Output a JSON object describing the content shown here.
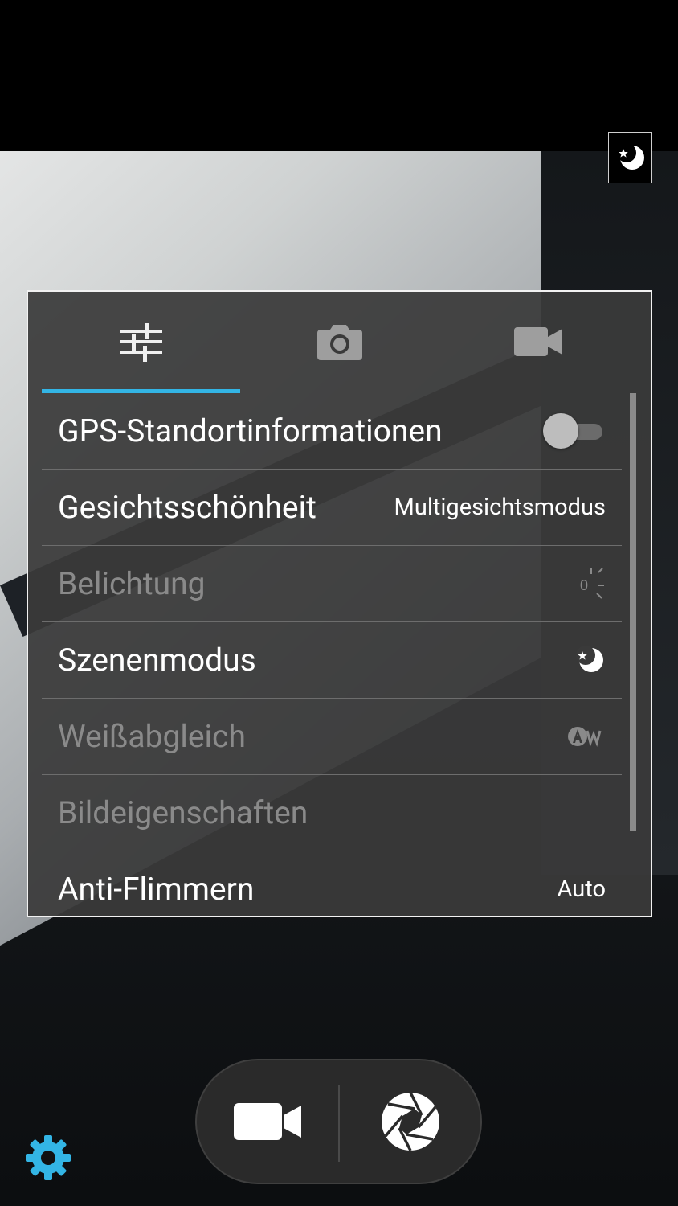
{
  "tabs": [
    {
      "name": "general",
      "icon": "sliders-icon",
      "selected": true
    },
    {
      "name": "photo",
      "icon": "camera-icon",
      "selected": false
    },
    {
      "name": "video",
      "icon": "videocam-icon",
      "selected": false
    }
  ],
  "settings": [
    {
      "label": "GPS-Standortinformationen",
      "value": "",
      "control": "toggle",
      "enabled": true,
      "toggle_on": false
    },
    {
      "label": "Gesichtsschönheit",
      "value": "Multigesichtsmodus",
      "enabled": true
    },
    {
      "label": "Belichtung",
      "value": "0",
      "icon": "exposure-icon",
      "enabled": false
    },
    {
      "label": "Szenenmodus",
      "value": "",
      "icon": "night-scene-icon",
      "enabled": true
    },
    {
      "label": "Weißabgleich",
      "value": "",
      "icon": "white-balance-auto-icon",
      "enabled": false
    },
    {
      "label": "Bildeigenschaften",
      "value": "",
      "enabled": false
    },
    {
      "label": "Anti-Flimmern",
      "value": "Auto",
      "enabled": true
    }
  ],
  "colors": {
    "accent": "#33b5e5",
    "panel_bg": "#3a3a3a",
    "text_enabled": "#ffffff",
    "text_disabled": "#8a8a8a"
  },
  "icons": {
    "top_indicator": "night-scene-icon",
    "bottom_left": "settings-gear-icon",
    "record": "videocam-icon",
    "shutter": "shutter-icon"
  }
}
